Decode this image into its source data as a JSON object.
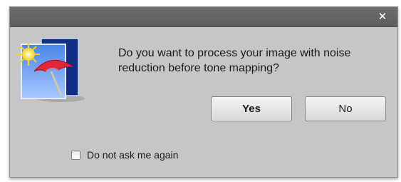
{
  "dialog": {
    "close_symbol": "✕",
    "close_icon": "close-icon",
    "app_icon": "beach-umbrella-photo-icon",
    "message": "Do you want to process your image with noise reduction before tone mapping?",
    "buttons": {
      "yes_label": "Yes",
      "no_label": "No"
    },
    "checkbox": {
      "label": "Do not ask me again",
      "checked": false
    }
  },
  "colors": {
    "dialog_background": "#c6c6c6",
    "titlebar": "#5e5e5e",
    "button_face": "#e6e6e6",
    "text": "#1a1a1a"
  }
}
